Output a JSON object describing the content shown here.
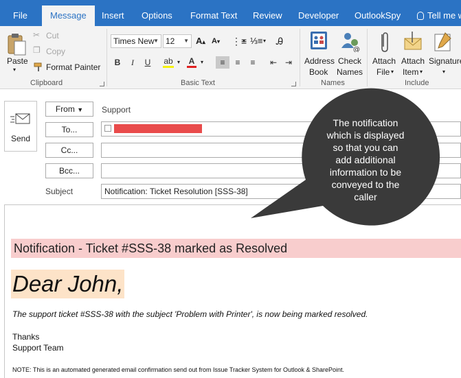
{
  "tabs": [
    "File",
    "Message",
    "Insert",
    "Options",
    "Format Text",
    "Review",
    "Developer",
    "OutlookSpy"
  ],
  "tell_me": "Tell me w",
  "ribbon": {
    "clipboard": {
      "paste": "Paste",
      "cut": "Cut",
      "copy": "Copy",
      "format_painter": "Format Painter",
      "label": "Clipboard"
    },
    "basic_text": {
      "font": "Times New",
      "size": "12",
      "label": "Basic Text"
    },
    "names": {
      "address_book_1": "Address",
      "address_book_2": "Book",
      "check_names_1": "Check",
      "check_names_2": "Names",
      "label": "Names"
    },
    "include": {
      "attach_file_1": "Attach",
      "attach_file_2": "File",
      "attach_item_1": "Attach",
      "attach_item_2": "Item",
      "signature": "Signature",
      "label": "Include"
    }
  },
  "header": {
    "send": "Send",
    "from": "From",
    "from_value": "Support",
    "to": "To...",
    "cc": "Cc...",
    "bcc": "Bcc...",
    "subject_label": "Subject",
    "subject_value": "Notification: Ticket Resolution [SSS-38]"
  },
  "callout": [
    "The notification",
    "which is displayed",
    "so that you can",
    "add additional",
    "information to be",
    "conveyed to the",
    "caller"
  ],
  "email_body": {
    "notice": "Notification - Ticket #SSS-38 marked as Resolved",
    "greeting": "Dear John,",
    "paragraph": "The support ticket #SSS-38 with the subject 'Problem with Printer', is now being marked resolved.",
    "thanks": "Thanks",
    "team": "Support Team",
    "note": "NOTE: This is an automated generated email confirmation send out from Issue Tracker System for Outlook & SharePoint."
  },
  "colors": {
    "ribbon_blue": "#2b73c4",
    "notice_bg": "#f8cdcd",
    "greeting_bg": "#fde3c8",
    "redacted": "#e94b4b",
    "callout_bg": "#3a3a3a"
  }
}
